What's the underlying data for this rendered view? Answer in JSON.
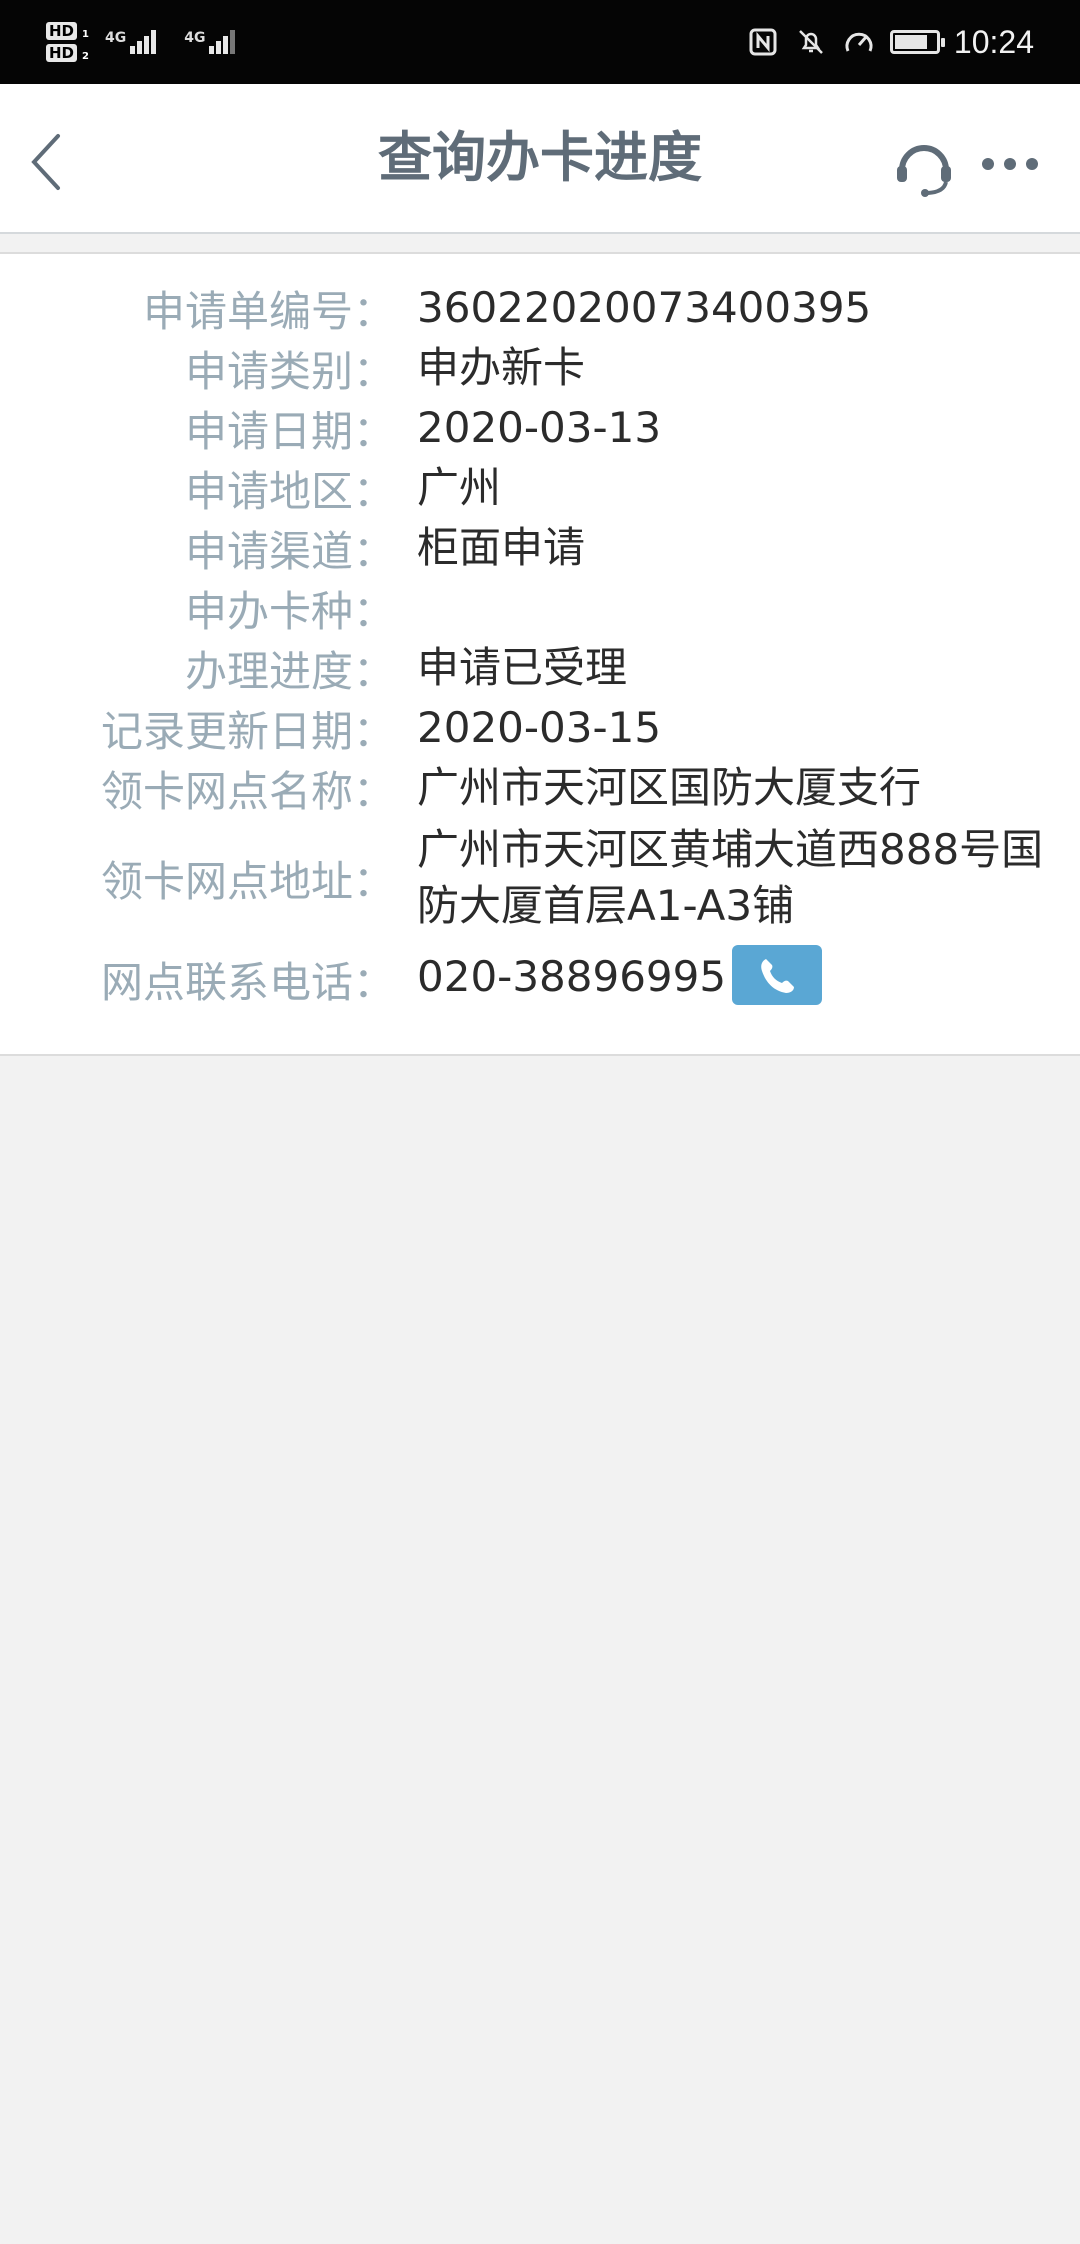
{
  "status_bar": {
    "sim1_label": "HD",
    "sim1_index": "1",
    "sim2_label": "HD",
    "sim2_index": "2",
    "network1": "4G",
    "network2": "4G",
    "time": "10:24",
    "icons": [
      "nfc-icon",
      "mute-icon",
      "data-saver-icon",
      "battery-icon"
    ]
  },
  "header": {
    "title": "查询办卡进度",
    "back_icon": "chevron-left-icon",
    "service_icon": "headset-icon",
    "more_icon": "more-dots-icon"
  },
  "details": {
    "application_no": {
      "label": "申请单编号：",
      "value": "36022020073400395"
    },
    "application_type": {
      "label": "申请类别：",
      "value": "申办新卡"
    },
    "application_date": {
      "label": "申请日期：",
      "value": "2020-03-13"
    },
    "region": {
      "label": "申请地区：",
      "value": "广州"
    },
    "channel": {
      "label": "申请渠道：",
      "value": "柜面申请"
    },
    "card_type": {
      "label": "申办卡种：",
      "value": ""
    },
    "progress": {
      "label": "办理进度：",
      "value": "申请已受理"
    },
    "update_date": {
      "label": "记录更新日期：",
      "value": "2020-03-15"
    },
    "branch_name": {
      "label": "领卡网点名称：",
      "value": "广州市天河区国防大厦支行"
    },
    "branch_address": {
      "label": "领卡网点地址：",
      "value": "广州市天河区黄埔大道西888号国防大厦首层A1-A3铺"
    },
    "branch_phone": {
      "label": "网点联系电话：",
      "value": "020-38896995"
    }
  },
  "colors": {
    "label": "#9aabb6",
    "value": "#2b2b2b",
    "title": "#5f6c78",
    "call_button": "#5aa7d4",
    "page_bg": "#f2f2f2"
  }
}
